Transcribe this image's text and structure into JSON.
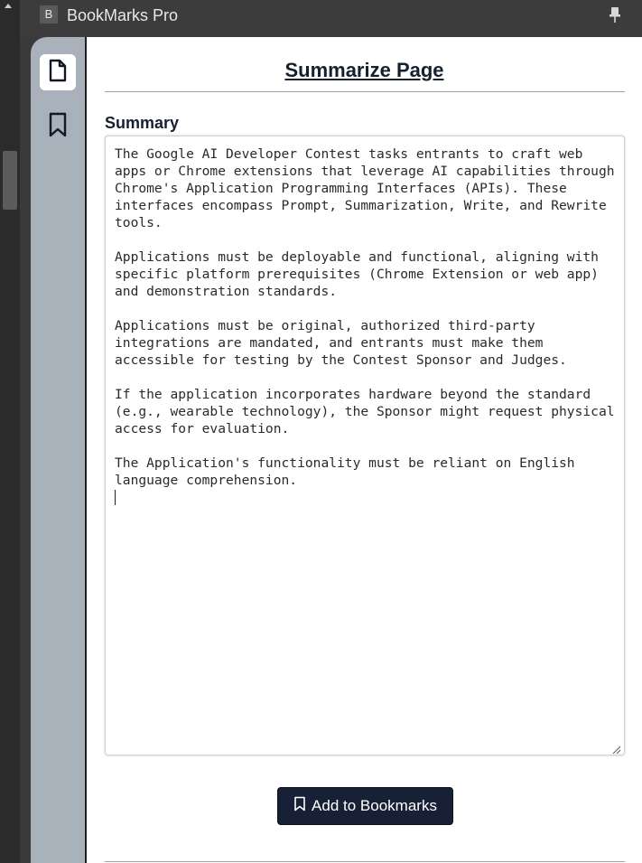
{
  "app": {
    "icon_letter": "B",
    "title": "BookMarks Pro"
  },
  "icons": {
    "pin": "pin-icon",
    "page": "page-icon",
    "bookmark": "bookmark-icon",
    "bookmark_button": "bookmark-icon"
  },
  "colors": {
    "titlebar": "#3c3c3c",
    "sidebar": "#a9b1bb",
    "heading": "#17202f",
    "button_bg": "#182035"
  },
  "main": {
    "heading": "Summarize Page",
    "summary_label": "Summary",
    "summary_text": "The Google AI Developer Contest tasks entrants to craft web apps or Chrome extensions that leverage AI capabilities through Chrome's Application Programming Interfaces (APIs). These interfaces encompass Prompt, Summarization, Write, and Rewrite tools.\n\nApplications must be deployable and functional, aligning with specific platform prerequisites (Chrome Extension or web app) and demonstration standards.\n\nApplications must be original, authorized third-party integrations are mandated, and entrants must make them accessible for testing by the Contest Sponsor and Judges.\n\nIf the application incorporates hardware beyond the standard (e.g., wearable technology), the Sponsor might request physical access for evaluation.\n\nThe Application's functionality must be reliant on English language comprehension.\n",
    "add_button_label": "Add to Bookmarks"
  }
}
